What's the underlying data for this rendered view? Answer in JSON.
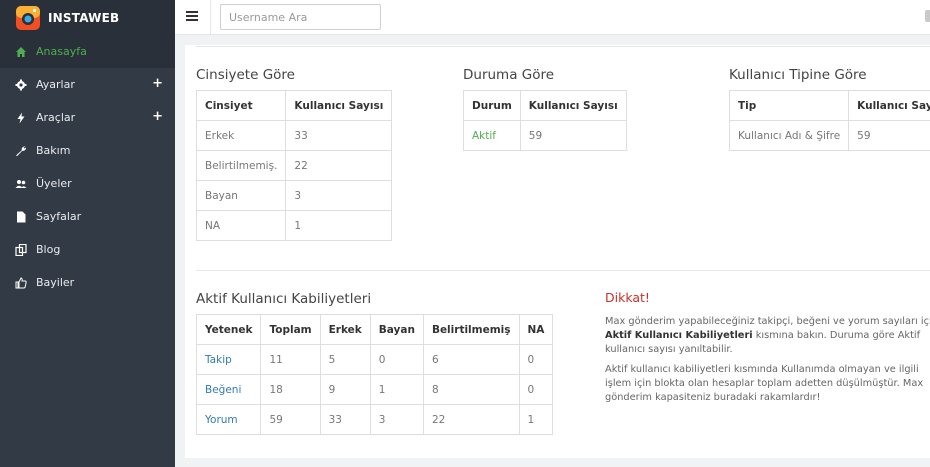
{
  "brand": {
    "name": "INSTAWEB"
  },
  "sidebar": {
    "items": [
      {
        "label": "Anasayfa",
        "icon": "home-icon",
        "active": true
      },
      {
        "label": "Ayarlar",
        "icon": "gear-icon",
        "expand": "+"
      },
      {
        "label": "Araçlar",
        "icon": "bolt-icon",
        "expand": "+"
      },
      {
        "label": "Bakım",
        "icon": "wrench-icon"
      },
      {
        "label": "Üyeler",
        "icon": "users-icon"
      },
      {
        "label": "Sayfalar",
        "icon": "file-icon"
      },
      {
        "label": "Blog",
        "icon": "copy-icon"
      },
      {
        "label": "Bayiler",
        "icon": "thumbs-up-icon"
      }
    ]
  },
  "search": {
    "placeholder": "Username Ara"
  },
  "gender": {
    "title": "Cinsiyete Göre",
    "headers": [
      "Cinsiyet",
      "Kullanıcı Sayısı"
    ],
    "rows": [
      [
        "Erkek",
        "33"
      ],
      [
        "Belirtilmemiş.",
        "22"
      ],
      [
        "Bayan",
        "3"
      ],
      [
        "NA",
        "1"
      ]
    ]
  },
  "status": {
    "title": "Duruma Göre",
    "headers": [
      "Durum",
      "Kullanıcı Sayısı"
    ],
    "rows": [
      [
        "Aktif",
        "59"
      ]
    ]
  },
  "usertype": {
    "title": "Kullanıcı Tipine Göre",
    "headers": [
      "Tip",
      "Kullanıcı Sayısı"
    ],
    "rows": [
      [
        "Kullanıcı Adı & Şifre",
        "59"
      ]
    ]
  },
  "abilities": {
    "title": "Aktif Kullanıcı Kabiliyetleri",
    "headers": [
      "Yetenek",
      "Toplam",
      "Erkek",
      "Bayan",
      "Belirtilmemiş",
      "NA"
    ],
    "rows": [
      [
        "Takip",
        "11",
        "5",
        "0",
        "6",
        "0"
      ],
      [
        "Beğeni",
        "18",
        "9",
        "1",
        "8",
        "0"
      ],
      [
        "Yorum",
        "59",
        "33",
        "3",
        "22",
        "1"
      ]
    ]
  },
  "warning": {
    "title": "Dikkat!",
    "p1_start": "Max gönderim yapabileceğiniz takipçi, beğeni ve yorum sayıları için ",
    "p1_bold": "Aktif Kullanıcı Kabiliyetleri",
    "p1_end": " kısmına bakın. Duruma göre Aktif kullanıcı sayısı yanıltabilir.",
    "p2": "Aktif kullanıcı kabiliyetleri kısmında Kullanımda olmayan ve ilgili işlem için blokta olan hesaplar toplam adetten düşülmüştür. Max gönderim kapasiteniz buradaki rakamlardır!"
  },
  "colors": {
    "sidebar": "#323a45",
    "accent": "#4caf50",
    "link": "#337ab7",
    "warning": "#c9302c"
  }
}
